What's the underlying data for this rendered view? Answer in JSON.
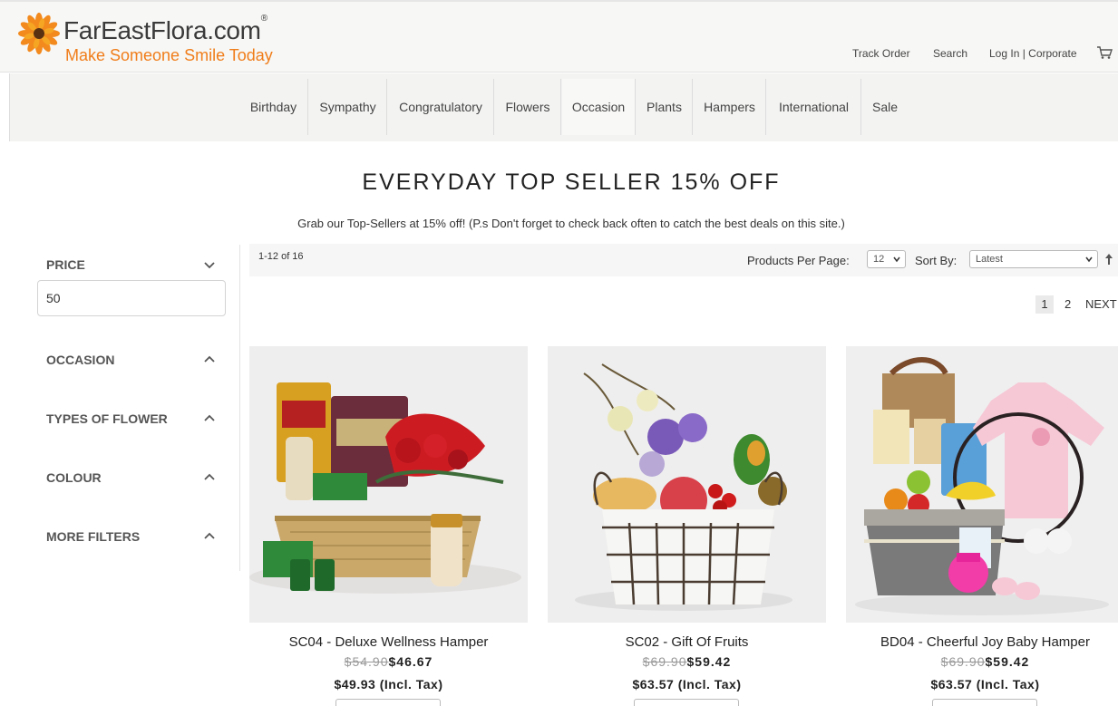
{
  "header": {
    "logo_name": "FarEastFlora.com",
    "logo_reg": "®",
    "logo_tagline": "Make Someone Smile Today",
    "links": {
      "track_order": "Track Order",
      "search": "Search",
      "login": "Log In | Corporate"
    },
    "icons": {
      "logo": "gerbera-flower-icon",
      "cart": "shopping-cart-icon"
    }
  },
  "nav": [
    "Birthday",
    "Sympathy",
    "Congratulatory",
    "Flowers",
    "Occasion",
    "Plants",
    "Hampers",
    "International",
    "Sale"
  ],
  "nav_active": "Occasion",
  "page": {
    "title": "EVERYDAY TOP SELLER 15% OFF",
    "subtitle": "Grab our Top-Sellers at 15% off! (P.s Don't forget to check back often to catch the best deals on this site.)"
  },
  "filters": {
    "price_label": "PRICE",
    "price_value": "50",
    "occasion": "OCCASION",
    "types_of_flower": "TYPES OF FLOWER",
    "colour": "COLOUR",
    "more_filters": "MORE FILTERS"
  },
  "toolbar": {
    "count": "1-12 of 16",
    "per_page_label": "Products Per Page:",
    "per_page_value": "12",
    "sort_label": "Sort By:",
    "sort_value": "Latest"
  },
  "pagination": {
    "current": "1",
    "page2": "2",
    "next": "NEXT"
  },
  "products": [
    {
      "name": "SC04 - Deluxe Wellness Hamper",
      "old_price": "$54.90",
      "new_price": "$46.67",
      "tax_price": "$49.93 (Incl. Tax)"
    },
    {
      "name": "SC02 - Gift Of Fruits",
      "old_price": "$69.90",
      "new_price": "$59.42",
      "tax_price": "$63.57 (Incl. Tax)"
    },
    {
      "name": "BD04 - Cheerful Joy Baby Hamper",
      "old_price": "$69.90",
      "new_price": "$59.42",
      "tax_price": "$63.57 (Incl. Tax)"
    }
  ],
  "colors": {
    "brand_orange": "#f07d1a",
    "nav_bg": "#f3f3f2",
    "header_bg": "#f7f7f5"
  }
}
